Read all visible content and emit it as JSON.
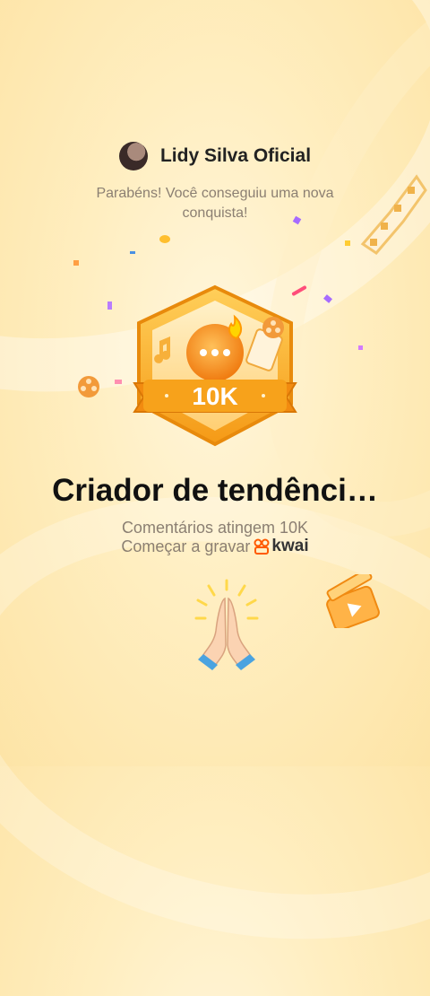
{
  "header": {
    "username": "Lidy Silva Oficial"
  },
  "message": {
    "line1": "Parabéns! Você conseguiu uma nova",
    "line2": "conquista!"
  },
  "badge": {
    "value_label": "10K"
  },
  "achievement": {
    "title": "Criador de tendênci…",
    "stat": "Comentários atingem 10K",
    "cta_text": "Começar a gravar",
    "brand": "kwai"
  },
  "colors": {
    "badge_gold": "#f5a623",
    "badge_orange": "#ff8a00",
    "text_muted": "#8b7f72",
    "brand_orange": "#ff5a00"
  },
  "icons": [
    "avatar",
    "trophy-badge-icon",
    "praying-hands-emoji",
    "clapperboard-icon",
    "film-reel-icon",
    "kwai-logo-icon"
  ]
}
